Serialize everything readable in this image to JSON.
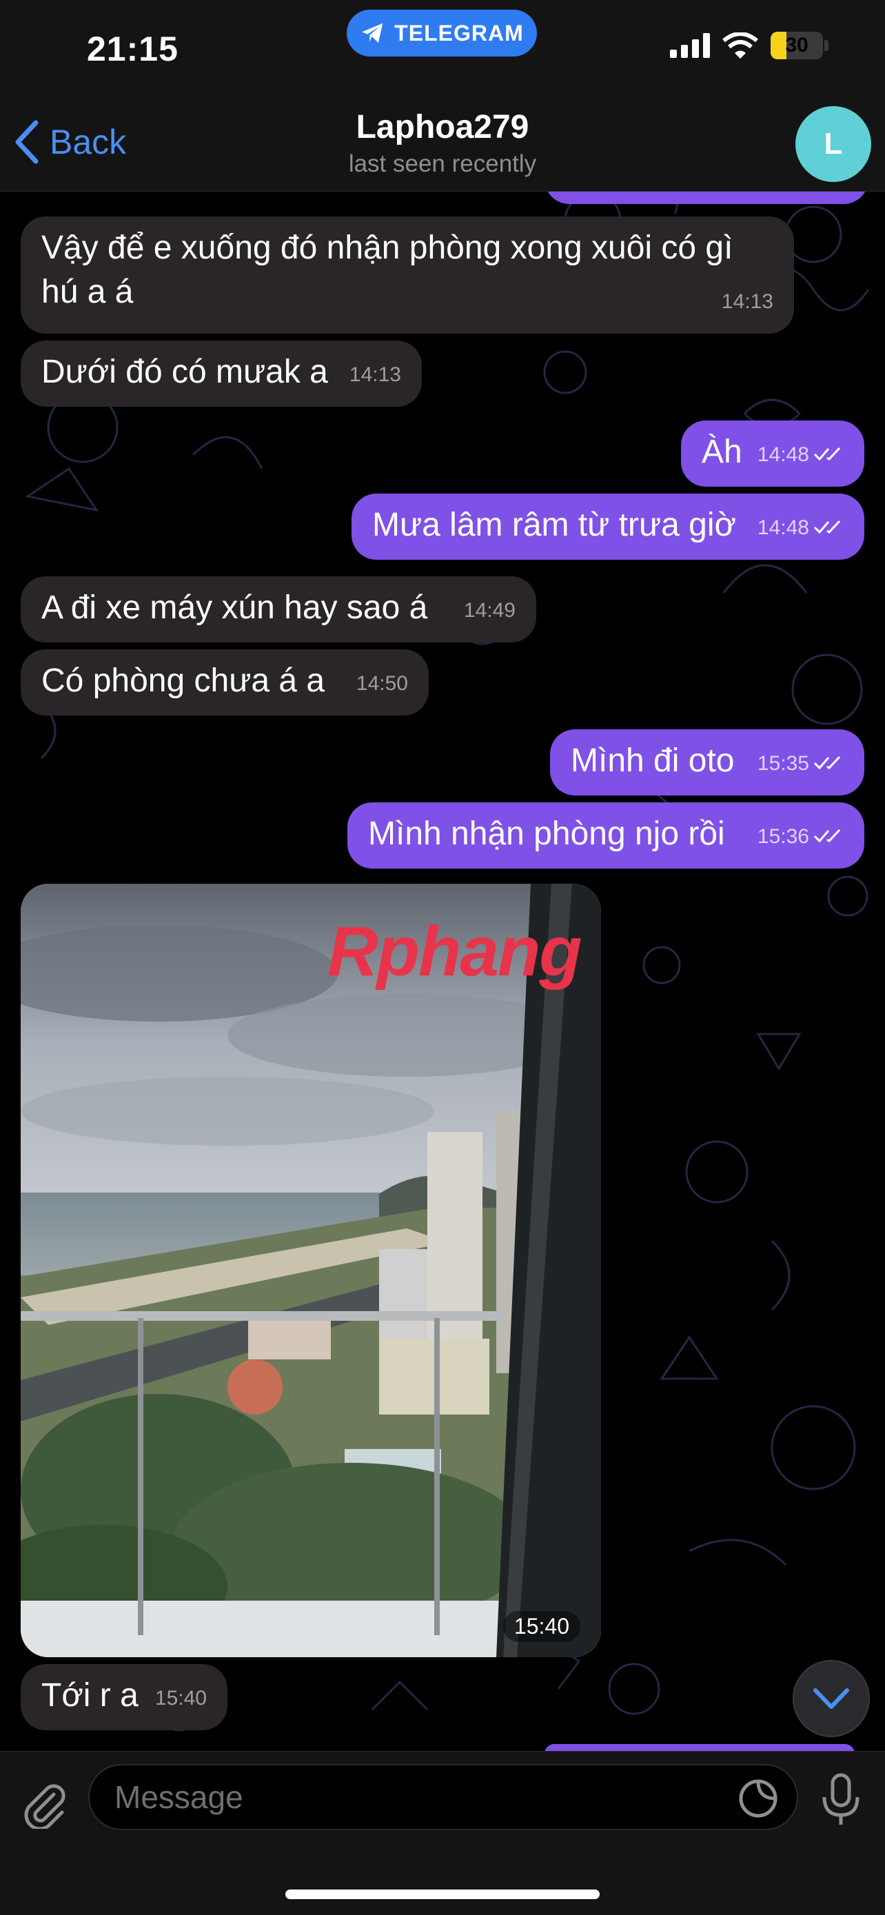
{
  "status_bar": {
    "time": "21:15",
    "app_pill": "TELEGRAM",
    "battery": "30",
    "battery_level": 0.3
  },
  "header": {
    "back_label": "Back",
    "contact_name": "Laphoa279",
    "contact_status": "last seen recently",
    "avatar_initial": "L"
  },
  "messages": [
    {
      "dir": "in",
      "text_line1": "Vậy để e xuống đó nhận phòng xong xuôi có gì",
      "text_line2": "hú  a á",
      "time": "14:13"
    },
    {
      "dir": "in",
      "text": "Dưới đó có mưak a",
      "time": "14:13"
    },
    {
      "dir": "out",
      "text": "Àh",
      "time": "14:48"
    },
    {
      "dir": "out",
      "text": "Mưa lâm râm từ trưa giờ",
      "time": "14:48"
    },
    {
      "dir": "in",
      "text": "A đi xe máy xún hay sao á",
      "time": "14:49"
    },
    {
      "dir": "in",
      "text": "Có phòng chưa á a",
      "time": "14:50"
    },
    {
      "dir": "out",
      "text": "Mình đi oto",
      "time": "15:35"
    },
    {
      "dir": "out",
      "text": "Mình nhận phòng njo rồi",
      "time": "15:36"
    },
    {
      "dir": "in",
      "type": "photo",
      "watermark": "Rphang",
      "time": "15:40"
    },
    {
      "dir": "in",
      "text": "Tới r a",
      "time": "15:40"
    }
  ],
  "input": {
    "placeholder": "Message"
  },
  "colors": {
    "outgoing_bubble": "#7f51e6",
    "incoming_bubble": "#2a2528",
    "accent": "#4a8ff2",
    "telegram_pill": "#2f7bf0",
    "avatar": "#5fd0d6"
  },
  "icons": [
    "telegram-plane-icon",
    "signal-icon",
    "wifi-icon",
    "battery-icon",
    "chevron-left-icon",
    "double-check-icon",
    "chevron-down-icon",
    "paperclip-icon",
    "sticker-icon",
    "microphone-icon"
  ]
}
